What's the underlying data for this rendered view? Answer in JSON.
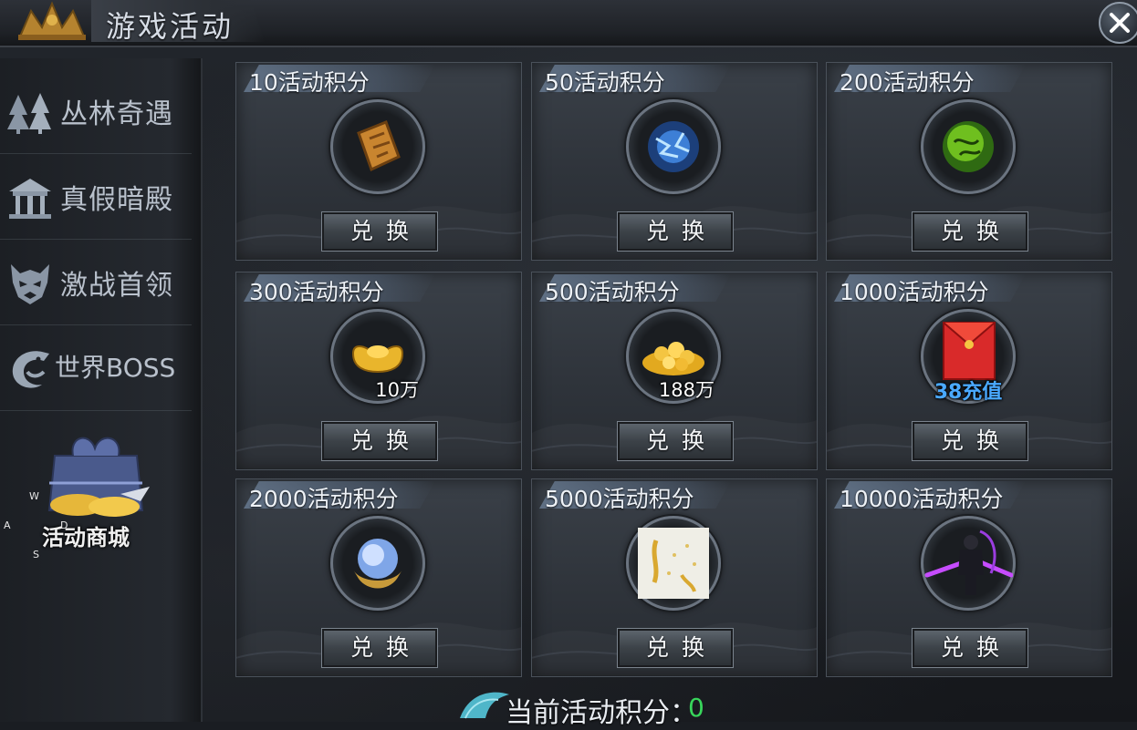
{
  "window": {
    "title": "游戏活动",
    "close_icon": "close-icon"
  },
  "sidebar": {
    "items": [
      {
        "label": "丛林奇遇",
        "icon": "forest-icon"
      },
      {
        "label": "真假暗殿",
        "icon": "temple-icon"
      },
      {
        "label": "激战首领",
        "icon": "demon-mask-icon"
      },
      {
        "label": "世界BOSS",
        "icon": "dragon-icon"
      }
    ],
    "shop": {
      "label": "活动商城",
      "icon": "gift-bundle-icon"
    },
    "key_hints": [
      "W",
      "A",
      "D",
      "S"
    ]
  },
  "rewards": [
    {
      "cost": "10活动积分",
      "item_icon": "token-plaque-icon",
      "qty": "",
      "button": "兑换"
    },
    {
      "cost": "50活动积分",
      "item_icon": "lightning-orb-icon",
      "qty": "",
      "button": "兑换"
    },
    {
      "cost": "200活动积分",
      "item_icon": "green-orb-icon",
      "qty": "",
      "button": "兑换"
    },
    {
      "cost": "300活动积分",
      "item_icon": "gold-ingot-icon",
      "qty": "10万",
      "button": "兑换"
    },
    {
      "cost": "500活动积分",
      "item_icon": "gold-pile-icon",
      "qty": "188万",
      "button": "兑换"
    },
    {
      "cost": "1000活动积分",
      "item_icon": "red-envelope-icon",
      "qty": "38充值",
      "button": "兑换"
    },
    {
      "cost": "2000活动积分",
      "item_icon": "moon-orb-icon",
      "qty": "",
      "button": "兑换"
    },
    {
      "cost": "5000活动积分",
      "item_icon": "scroll-card-icon",
      "qty": "",
      "button": "兑换"
    },
    {
      "cost": "10000活动积分",
      "item_icon": "dark-warrior-icon",
      "qty": "",
      "button": "兑换"
    }
  ],
  "footer": {
    "label": "当前活动积分：",
    "value": "0"
  },
  "colors": {
    "points_value": "#38d65b",
    "recharge_text": "#4aa9ff"
  }
}
